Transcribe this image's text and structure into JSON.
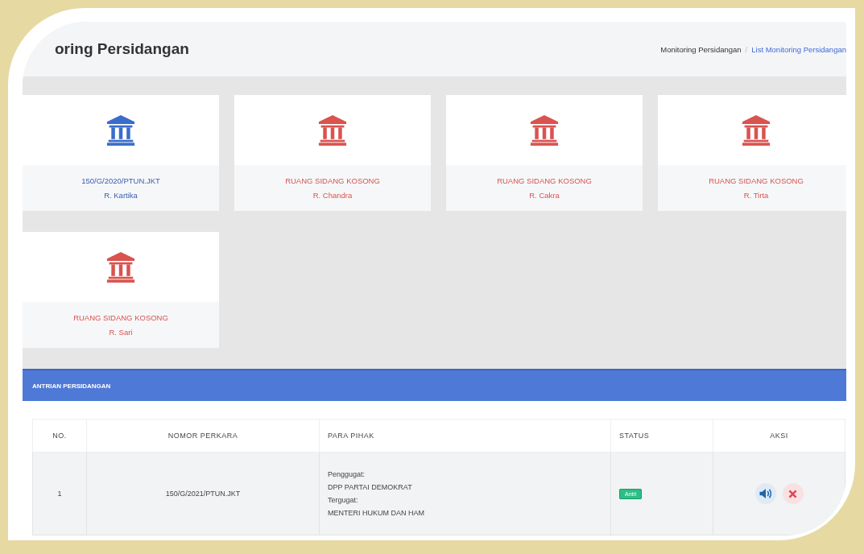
{
  "page": {
    "title": "oring Persidangan"
  },
  "breadcrumb": {
    "items": [
      {
        "label": "Monitoring Persidangan",
        "link": false
      },
      {
        "label": "List Monitoring Persidangan",
        "link": true
      }
    ],
    "separator": "/"
  },
  "rooms": [
    {
      "case": "150/G/2020/PTUN.JKT",
      "room": "R. Kartika",
      "occupied": true
    },
    {
      "case": "RUANG SIDANG KOSONG",
      "room": "R. Chandra",
      "occupied": false
    },
    {
      "case": "RUANG SIDANG KOSONG",
      "room": "R. Cakra",
      "occupied": false
    },
    {
      "case": "RUANG SIDANG KOSONG",
      "room": "R. Tirta",
      "occupied": false
    },
    {
      "case": "RUANG SIDANG KOSONG",
      "room": "R. Sari",
      "occupied": false
    }
  ],
  "queue": {
    "title": "ANTRIAN PERSIDANGAN",
    "columns": [
      "NO.",
      "NOMOR PERKARA",
      "PARA PIHAK",
      "STATUS",
      "AKSI"
    ],
    "rows": [
      {
        "no": "1",
        "case": "150/G/2021/PTUN.JKT",
        "parties": [
          "Penggugat:",
          "DPP PARTAI DEMOKRAT",
          "Tergugat:",
          "MENTERI HUKUM DAN HAM"
        ],
        "status": "Antri"
      }
    ]
  }
}
